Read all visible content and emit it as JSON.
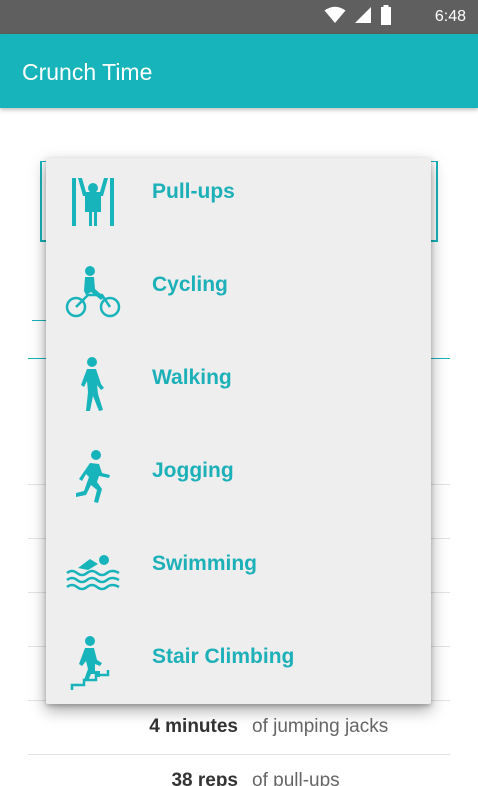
{
  "status_bar": {
    "time": "6:48",
    "icons": [
      "wifi-icon",
      "cell-signal-icon",
      "battery-icon"
    ]
  },
  "app_bar": {
    "title": "Crunch Time"
  },
  "colors": {
    "accent": "#18b4bb",
    "status_bar": "#5f5f5f",
    "dropdown_bg": "#eeeeee"
  },
  "dropdown": {
    "items": [
      {
        "label": "Pull-ups",
        "icon": "pull-ups-icon"
      },
      {
        "label": "Cycling",
        "icon": "cycling-icon"
      },
      {
        "label": "Walking",
        "icon": "walking-icon"
      },
      {
        "label": "Jogging",
        "icon": "jogging-icon"
      },
      {
        "label": "Swimming",
        "icon": "swimming-icon"
      },
      {
        "label": "Stair Climbing",
        "icon": "stair-climbing-icon"
      }
    ]
  },
  "results": [
    {
      "amount": "4 minutes",
      "exercise": "of jumping jacks"
    },
    {
      "amount": "38 reps",
      "exercise": "of pull-ups"
    }
  ]
}
